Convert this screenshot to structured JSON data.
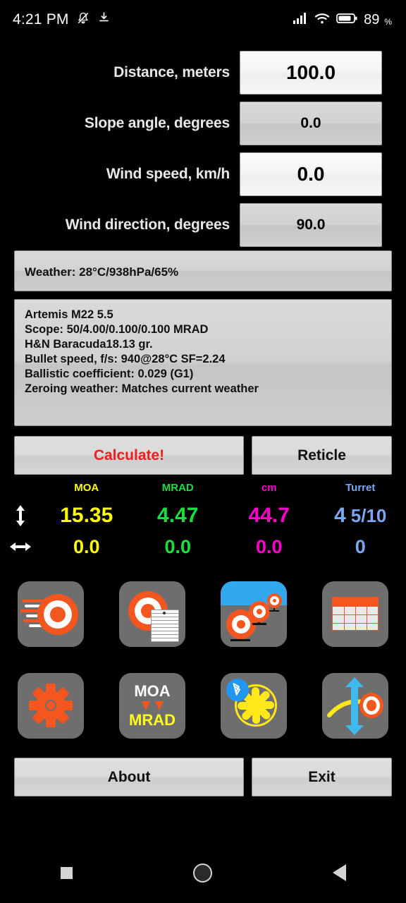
{
  "statusbar": {
    "time": "4:21 PM",
    "icons_left": [
      "bell-muted-icon",
      "download-icon"
    ],
    "icons_right": [
      "signal-icon",
      "wifi-icon",
      "battery-icon"
    ],
    "battery_level": "89",
    "battery_unit": "%"
  },
  "inputs": [
    {
      "label": "Distance, meters",
      "value": "100.0",
      "style": "light"
    },
    {
      "label": "Slope angle, degrees",
      "value": "0.0",
      "style": "dark"
    },
    {
      "label": "Wind speed, km/h",
      "value": "0.0",
      "style": "light"
    },
    {
      "label": "Wind direction, degrees",
      "value": "90.0",
      "style": "dark"
    }
  ],
  "weather": {
    "text": "Weather: 28°C/938hPa/65%"
  },
  "rifle": {
    "lines": [
      "Artemis M22 5.5",
      "Scope: 50/4.00/0.100/0.100 MRAD",
      "H&N Baracuda18.13 gr.",
      "Bullet speed, f/s: 940@28°C SF=2.24",
      "Ballistic coefficient: 0.029 (G1)",
      "Zeroing weather: Matches current weather"
    ]
  },
  "actions": {
    "calculate": "Calculate!",
    "reticle": "Reticle",
    "about": "About",
    "exit": "Exit"
  },
  "results": {
    "headers": [
      "MOA",
      "MRAD",
      "cm",
      "Turret"
    ],
    "colors": {
      "moa": "#ffff00",
      "mrad": "#19e03c",
      "cm": "#ff00cc",
      "turret": "#7aa7f0"
    },
    "rows": [
      {
        "axis": "vertical",
        "moa": "15.35",
        "mrad": "4.47",
        "cm": "44.7",
        "turret_whole": "4",
        "turret_fraction": "5/10"
      },
      {
        "axis": "horizontal",
        "moa": "0.0",
        "mrad": "0.0",
        "cm": "0.0",
        "turret_whole": "0",
        "turret_fraction": ""
      }
    ]
  },
  "tiles": [
    {
      "name": "bullet-speed-icon",
      "label": ""
    },
    {
      "name": "shot-list-icon",
      "label": ""
    },
    {
      "name": "zeroing-range-icon",
      "label": ""
    },
    {
      "name": "ballistic-table-icon",
      "label": ""
    },
    {
      "name": "settings-gear-icon",
      "label": ""
    },
    {
      "name": "moa-mrad-converter-icon",
      "label_top": "MOA",
      "label_bottom": "MRAD"
    },
    {
      "name": "bluetooth-weather-meter-icon",
      "label": ""
    },
    {
      "name": "trajectory-icon",
      "label": ""
    }
  ],
  "navbar": {
    "recent": "recents-icon",
    "home": "home-icon",
    "back": "back-icon"
  }
}
